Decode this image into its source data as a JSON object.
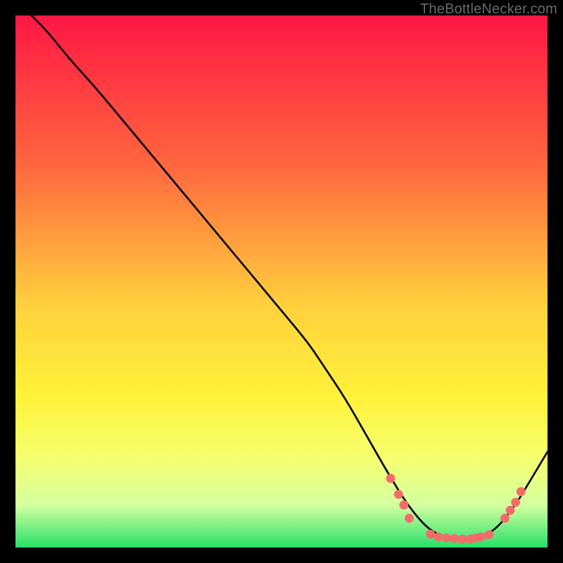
{
  "watermark": "TheBottleNecker.com",
  "colors": {
    "black": "#000000",
    "curve": "#000000",
    "dot": "#f56b6b",
    "grad_top": "#ff1744",
    "grad_mid_upper": "#ff8a3d",
    "grad_mid": "#ffe642",
    "grad_low1": "#f8ff6e",
    "grad_low2": "#e1ffb0",
    "grad_bottom": "#28e06a"
  },
  "chart_data": {
    "type": "line",
    "title": "",
    "xlabel": "",
    "ylabel": "",
    "xlim": [
      0,
      100
    ],
    "ylim": [
      0,
      100
    ],
    "curve": {
      "x": [
        3,
        6,
        10,
        15,
        20,
        25,
        30,
        35,
        40,
        45,
        50,
        55,
        58,
        62,
        66,
        70,
        74,
        78,
        82,
        86,
        90,
        94,
        97,
        100
      ],
      "y": [
        100,
        97,
        92,
        86.5,
        80.5,
        74.5,
        68.5,
        62.5,
        56.5,
        50.5,
        44.5,
        38.5,
        34,
        28,
        21,
        14,
        7.5,
        3,
        1.5,
        1.5,
        3,
        8,
        13,
        18
      ]
    },
    "dots": [
      {
        "x": 70.5,
        "y": 13
      },
      {
        "x": 72,
        "y": 10
      },
      {
        "x": 73,
        "y": 8
      },
      {
        "x": 74,
        "y": 5.5
      },
      {
        "x": 78,
        "y": 2.5
      },
      {
        "x": 79.5,
        "y": 2
      },
      {
        "x": 81,
        "y": 1.8
      },
      {
        "x": 82.5,
        "y": 1.7
      },
      {
        "x": 84,
        "y": 1.6
      },
      {
        "x": 85.5,
        "y": 1.6
      },
      {
        "x": 86.5,
        "y": 1.8
      },
      {
        "x": 87.5,
        "y": 2
      },
      {
        "x": 89,
        "y": 2.4
      },
      {
        "x": 92,
        "y": 5.5
      },
      {
        "x": 93,
        "y": 7
      },
      {
        "x": 94,
        "y": 8.5
      },
      {
        "x": 95,
        "y": 10.5
      }
    ],
    "gradient_stops": [
      {
        "offset": 0,
        "color": "#ff1744"
      },
      {
        "offset": 28,
        "color": "#ff663f"
      },
      {
        "offset": 55,
        "color": "#ffd23d"
      },
      {
        "offset": 72,
        "color": "#fff23a"
      },
      {
        "offset": 83,
        "color": "#f6ff6e"
      },
      {
        "offset": 92,
        "color": "#d4ffa0"
      },
      {
        "offset": 100,
        "color": "#28e06a"
      }
    ]
  }
}
